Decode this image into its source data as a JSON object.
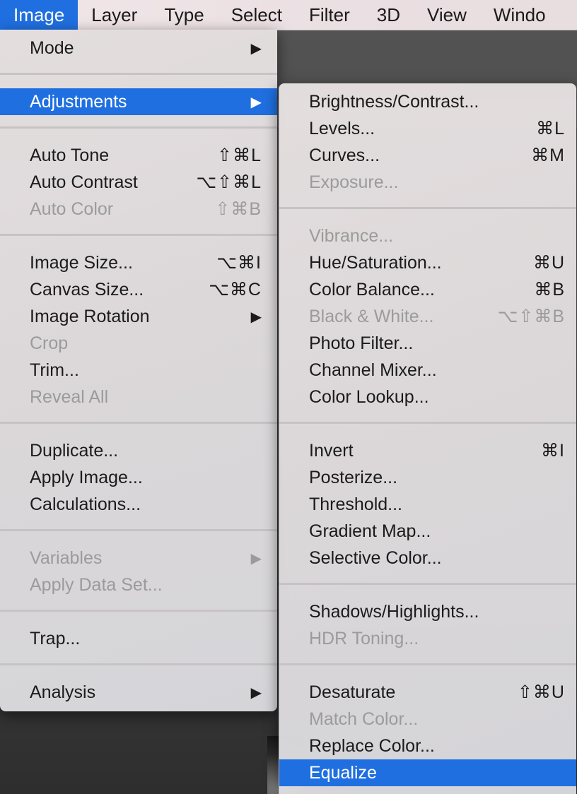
{
  "menubar": {
    "items": [
      "Image",
      "Layer",
      "Type",
      "Select",
      "Filter",
      "3D",
      "View",
      "Windo"
    ]
  },
  "image_menu": {
    "items": [
      {
        "label": "Mode",
        "shortcut": "",
        "submenu": true,
        "disabled": false
      },
      {
        "label": "Adjustments",
        "shortcut": "",
        "submenu": true,
        "disabled": false,
        "selected": true
      },
      {
        "label": "Auto Tone",
        "shortcut": "⇧⌘L",
        "disabled": false
      },
      {
        "label": "Auto Contrast",
        "shortcut": "⌥⇧⌘L",
        "disabled": false
      },
      {
        "label": "Auto Color",
        "shortcut": "⇧⌘B",
        "disabled": true
      },
      {
        "label": "Image Size...",
        "shortcut": "⌥⌘I",
        "disabled": false
      },
      {
        "label": "Canvas Size...",
        "shortcut": "⌥⌘C",
        "disabled": false
      },
      {
        "label": "Image Rotation",
        "shortcut": "",
        "submenu": true,
        "disabled": false
      },
      {
        "label": "Crop",
        "shortcut": "",
        "disabled": true
      },
      {
        "label": "Trim...",
        "shortcut": "",
        "disabled": false
      },
      {
        "label": "Reveal All",
        "shortcut": "",
        "disabled": true
      },
      {
        "label": "Duplicate...",
        "shortcut": "",
        "disabled": false
      },
      {
        "label": "Apply Image...",
        "shortcut": "",
        "disabled": false
      },
      {
        "label": "Calculations...",
        "shortcut": "",
        "disabled": false
      },
      {
        "label": "Variables",
        "shortcut": "",
        "submenu": true,
        "disabled": true
      },
      {
        "label": "Apply Data Set...",
        "shortcut": "",
        "disabled": true
      },
      {
        "label": "Trap...",
        "shortcut": "",
        "disabled": false
      },
      {
        "label": "Analysis",
        "shortcut": "",
        "submenu": true,
        "disabled": false
      }
    ],
    "submenu_arrow": "▶"
  },
  "adjustments_menu": {
    "items": [
      {
        "label": "Brightness/Contrast...",
        "shortcut": "",
        "disabled": false
      },
      {
        "label": "Levels...",
        "shortcut": "⌘L",
        "disabled": false
      },
      {
        "label": "Curves...",
        "shortcut": "⌘M",
        "disabled": false
      },
      {
        "label": "Exposure...",
        "shortcut": "",
        "disabled": true
      },
      {
        "label": "Vibrance...",
        "shortcut": "",
        "disabled": true
      },
      {
        "label": "Hue/Saturation...",
        "shortcut": "⌘U",
        "disabled": false
      },
      {
        "label": "Color Balance...",
        "shortcut": "⌘B",
        "disabled": false
      },
      {
        "label": "Black & White...",
        "shortcut": "⌥⇧⌘B",
        "disabled": true
      },
      {
        "label": "Photo Filter...",
        "shortcut": "",
        "disabled": false
      },
      {
        "label": "Channel Mixer...",
        "shortcut": "",
        "disabled": false
      },
      {
        "label": "Color Lookup...",
        "shortcut": "",
        "disabled": false
      },
      {
        "label": "Invert",
        "shortcut": "⌘I",
        "disabled": false
      },
      {
        "label": "Posterize...",
        "shortcut": "",
        "disabled": false
      },
      {
        "label": "Threshold...",
        "shortcut": "",
        "disabled": false
      },
      {
        "label": "Gradient Map...",
        "shortcut": "",
        "disabled": false
      },
      {
        "label": "Selective Color...",
        "shortcut": "",
        "disabled": false
      },
      {
        "label": "Shadows/Highlights...",
        "shortcut": "",
        "disabled": false
      },
      {
        "label": "HDR Toning...",
        "shortcut": "",
        "disabled": true
      },
      {
        "label": "Desaturate",
        "shortcut": "⇧⌘U",
        "disabled": false
      },
      {
        "label": "Match Color...",
        "shortcut": "",
        "disabled": true
      },
      {
        "label": "Replace Color...",
        "shortcut": "",
        "disabled": false
      },
      {
        "label": "Equalize",
        "shortcut": "",
        "disabled": false,
        "selected": true
      }
    ]
  },
  "colors": {
    "selection": "#1f6fe0",
    "disabled_text": "#9b9b9b"
  }
}
